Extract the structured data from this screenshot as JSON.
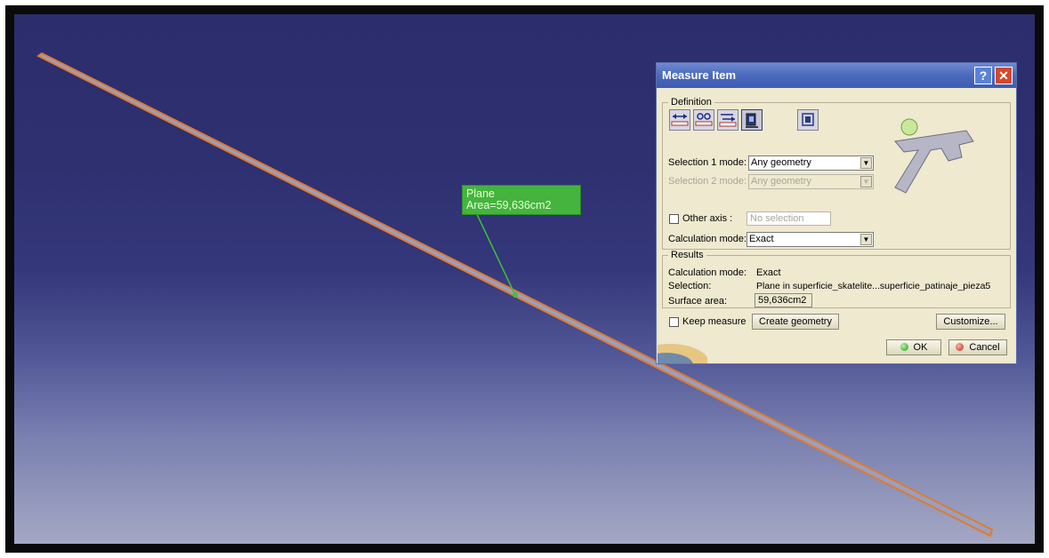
{
  "viewport": {
    "annotation": {
      "line1": "Plane",
      "line2": "Area=59,636cm2"
    }
  },
  "dialog": {
    "title": "Measure Item",
    "help_icon": "?",
    "close_icon": "✕",
    "definition": {
      "legend": "Definition",
      "mode_icons": [
        "measure-between-icon",
        "measure-item-between-icon",
        "measure-chain-icon",
        "measure-item-icon",
        "measure-thickness-icon"
      ],
      "selection1_label": "Selection 1 mode:",
      "selection1_value": "Any geometry",
      "selection2_label": "Selection 2 mode:",
      "selection2_value": "Any geometry",
      "other_axis_label": "Other axis :",
      "other_axis_placeholder": "No selection",
      "calc_mode_label": "Calculation mode:",
      "calc_mode_value": "Exact"
    },
    "results": {
      "legend": "Results",
      "calc_mode_label": "Calculation mode:",
      "calc_mode_value": "Exact",
      "selection_label": "Selection:",
      "selection_value": "Plane in superficie_skatelite...superficie_patinaje_pieza5",
      "surface_area_label": "Surface area:",
      "surface_area_value": "59,636cm2"
    },
    "keep_measure_label": "Keep measure",
    "create_geometry_label": "Create geometry",
    "customize_label": "Customize...",
    "ok_label": "OK",
    "cancel_label": "Cancel"
  },
  "colors": {
    "plane_edge": "#e07a2e",
    "plane_face": "#9aa0c0",
    "annotation_bg": "#44b43e",
    "dialog_title": "#4a69bd",
    "dialog_bg": "#eee9cf"
  }
}
